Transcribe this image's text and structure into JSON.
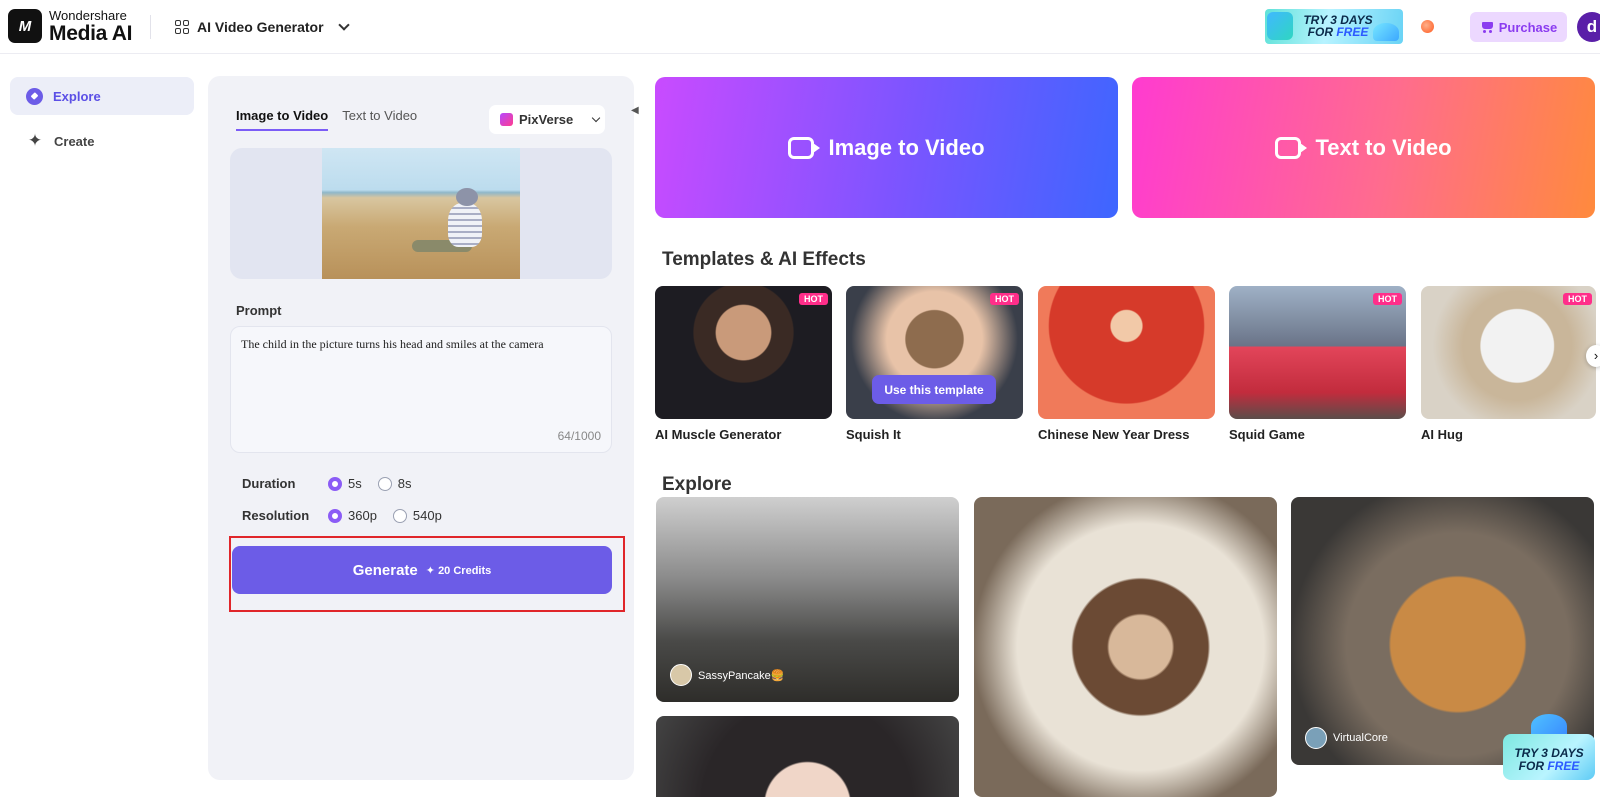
{
  "header": {
    "logo_glyph": "M",
    "brand_top": "Wondershare",
    "brand_main": "Media AI",
    "product": "AI Video Generator",
    "trial_line1": "TRY 3 DAYS",
    "trial_line2_prefix": "FOR ",
    "trial_line2_free": "FREE",
    "purchase": "Purchase",
    "avatar_letter": "d"
  },
  "nav": {
    "items": [
      {
        "label": "Explore",
        "icon": "compass-icon",
        "active": true
      },
      {
        "label": "Create",
        "icon": "sparkle-icon",
        "active": false
      }
    ]
  },
  "form": {
    "tabs": [
      {
        "label": "Image to Video",
        "active": true
      },
      {
        "label": "Text to Video",
        "active": false
      }
    ],
    "model": "PixVerse",
    "prompt_label": "Prompt",
    "prompt_value": "The child in the picture turns his head and smiles at the camera",
    "counter": "64/1000",
    "duration": {
      "label": "Duration",
      "options": [
        "5s",
        "8s"
      ],
      "selected": "5s"
    },
    "resolution": {
      "label": "Resolution",
      "options": [
        "360p",
        "540p"
      ],
      "selected": "360p"
    },
    "generate": {
      "label": "Generate",
      "credits": "20 Credits"
    }
  },
  "hero": {
    "image_to_video": "Image to Video",
    "text_to_video": "Text to Video"
  },
  "templates": {
    "title": "Templates & AI Effects",
    "hot_label": "HOT",
    "use_label": "Use this template",
    "items": [
      {
        "name": "AI Muscle Generator",
        "hot": true
      },
      {
        "name": "Squish It",
        "hot": true
      },
      {
        "name": "Chinese New Year Dress",
        "hot": false
      },
      {
        "name": "Squid Game",
        "hot": true
      },
      {
        "name": "AI Hug",
        "hot": true
      }
    ]
  },
  "explore": {
    "title": "Explore",
    "cards": [
      {
        "creator": "SassyPancake🍔"
      },
      {
        "creator": ""
      },
      {
        "creator": "VirtualCore"
      },
      {
        "creator": ""
      }
    ]
  },
  "colors": {
    "accent": "#6c5ce7",
    "hot": "#ff2e8a",
    "highlight": "#e0262a"
  }
}
